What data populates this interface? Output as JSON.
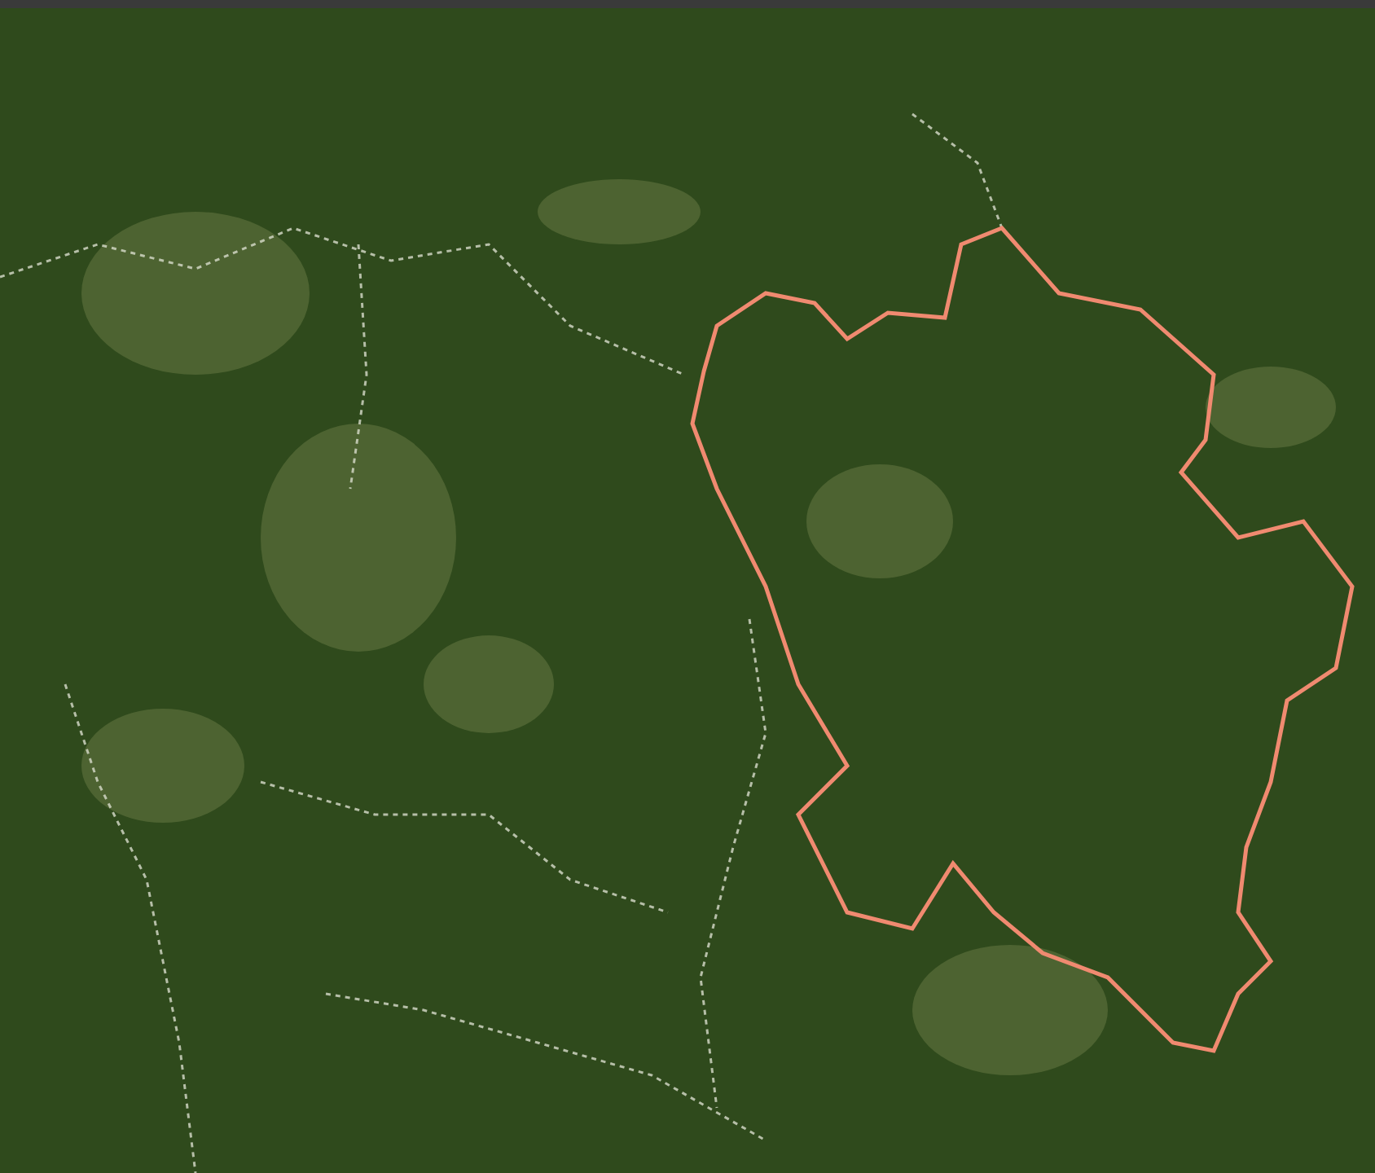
{
  "scene": {
    "kind": "satellite-map"
  }
}
